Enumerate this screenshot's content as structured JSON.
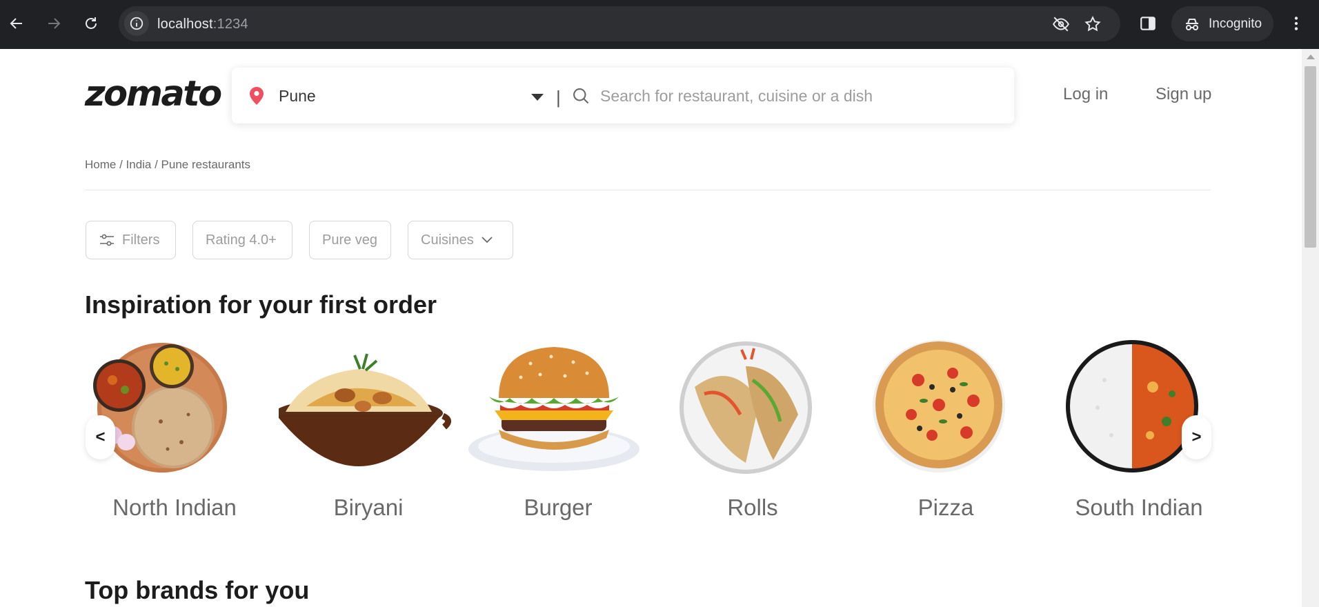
{
  "browser": {
    "url_host": "localhost",
    "url_port": ":1234",
    "incognito_label": "Incognito"
  },
  "header": {
    "logo": "zomato",
    "location": "Pune",
    "search_placeholder": "Search for restaurant, cuisine or a dish",
    "divider": "|",
    "login_label": "Log in",
    "signup_label": "Sign up"
  },
  "breadcrumb": "Home / India / Pune restaurants",
  "filters": {
    "filters_label": "Filters",
    "rating_label": "Rating 4.0+",
    "pureveg_label": "Pure veg",
    "cuisines_label": "Cuisines"
  },
  "inspiration": {
    "title": "Inspiration for your first order",
    "prev_label": "<",
    "next_label": ">",
    "items": [
      {
        "label": "North Indian",
        "icon": "north-indian-thali-image"
      },
      {
        "label": "Biryani",
        "icon": "biryani-bowl-image"
      },
      {
        "label": "Burger",
        "icon": "burger-image"
      },
      {
        "label": "Rolls",
        "icon": "rolls-image"
      },
      {
        "label": "Pizza",
        "icon": "pizza-image"
      },
      {
        "label": "South Indian",
        "icon": "south-indian-meal-image"
      }
    ]
  },
  "brands": {
    "title": "Top brands for you"
  },
  "colors": {
    "chrome_bg": "#202124",
    "brand_dark": "#1c1c1c",
    "pin": "#ef4f5f",
    "muted": "#696969"
  }
}
